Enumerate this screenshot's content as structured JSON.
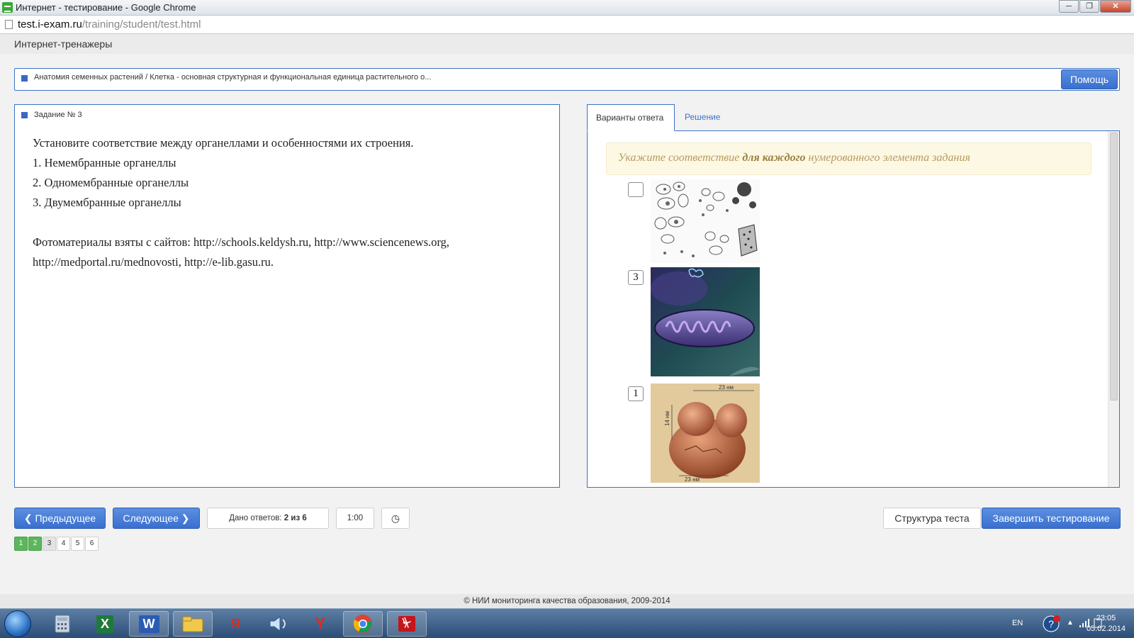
{
  "window": {
    "title": "Интернет - тестирование - Google Chrome",
    "url_host": "test.i-exam.ru",
    "url_path": "/training/student/test.html",
    "controls": [
      "─",
      "❐",
      "✕"
    ]
  },
  "app": {
    "brand": "Интернет-тренажеры"
  },
  "breadcrumb": {
    "text": "Анатомия семенных растений / Клетка - основная структурная и функциональная единица растительного о...",
    "help_label": "Помощь"
  },
  "task": {
    "number_label": "Задание № 3",
    "question": "Установите соответствие между органеллами и особенностями их строения.",
    "options": [
      "1. Немембранные органеллы",
      "2. Одномембранные органеллы",
      "3. Двумембранные органеллы"
    ],
    "credits_line1": "Фотоматериалы взяты с сайтов: http://schools.keldysh.ru, http://www.sciencenews.org,",
    "credits_line2": "http://medportal.ru/mednovosti, http://e-lib.gasu.ru."
  },
  "answers": {
    "tab_variants": "Варианты ответа",
    "tab_solution": "Решение",
    "instruction_pre": "Укажите соответствие ",
    "instruction_bold": "для каждого",
    "instruction_post": " нумерованного элемента задания",
    "items": [
      {
        "value": "",
        "image": "vesicles-drawing"
      },
      {
        "value": "3",
        "image": "mitochondrion"
      },
      {
        "value": "1",
        "image": "ribosome"
      }
    ],
    "ribosome_label_top": "23 нм",
    "ribosome_label_side": "14 нм",
    "ribosome_label_bottom": "23 нм"
  },
  "nav": {
    "prev_label": "Предыдущее",
    "next_label": "Следующее",
    "answered_label": "Дано ответов: ",
    "answered_value": "2 из 6",
    "timer": "1:00",
    "structure_label": "Структура теста",
    "finish_label": "Завершить тестирование",
    "pages": [
      "1",
      "2",
      "3",
      "4",
      "5",
      "6"
    ]
  },
  "footer": {
    "text": "© НИИ мониторинга качества образования, 2009-2014"
  },
  "taskbar": {
    "lang": "EN",
    "time": "23:05",
    "date": "05.02.2014",
    "apps": [
      "calculator",
      "excel",
      "word",
      "explorer",
      "yandex",
      "sound",
      "yandex-browser",
      "chrome",
      "acrobat"
    ],
    "app_glyphs": {
      "excel": "X",
      "word": "W",
      "yandex": "Я",
      "yandex_browser": "Y",
      "acrobat": "⏧"
    }
  },
  "colors": {
    "accent": "#3b73c4",
    "button": "#3a6fcf",
    "done": "#5bb75b",
    "instruction_bg": "#fcf8e3"
  }
}
